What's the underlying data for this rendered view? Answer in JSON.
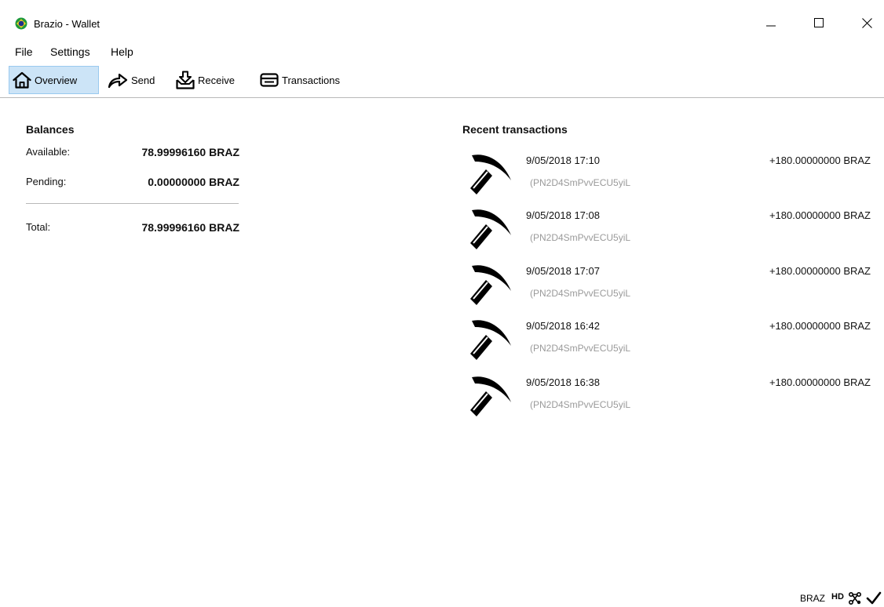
{
  "window": {
    "title": "Brazio - Wallet"
  },
  "menu": {
    "file": "File",
    "settings": "Settings",
    "help": "Help"
  },
  "toolbar": {
    "overview": "Overview",
    "send": "Send",
    "receive": "Receive",
    "transactions": "Transactions"
  },
  "balances": {
    "heading": "Balances",
    "available_label": "Available:",
    "available_value": "78.99996160 BRAZ",
    "pending_label": "Pending:",
    "pending_value": "0.00000000 BRAZ",
    "total_label": "Total:",
    "total_value": "78.99996160 BRAZ"
  },
  "recent": {
    "heading": "Recent transactions",
    "items": [
      {
        "icon": "pickaxe-icon",
        "date": "9/05/2018 17:10",
        "address": "(PN2D4SmPvvECU5yiL",
        "amount": "+180.00000000 BRAZ"
      },
      {
        "icon": "pickaxe-icon",
        "date": "9/05/2018 17:08",
        "address": "(PN2D4SmPvvECU5yiL",
        "amount": "+180.00000000 BRAZ"
      },
      {
        "icon": "pickaxe-icon",
        "date": "9/05/2018 17:07",
        "address": "(PN2D4SmPvvECU5yiL",
        "amount": "+180.00000000 BRAZ"
      },
      {
        "icon": "pickaxe-icon",
        "date": "9/05/2018 16:42",
        "address": "(PN2D4SmPvvECU5yiL",
        "amount": "+180.00000000 BRAZ"
      },
      {
        "icon": "pickaxe-icon",
        "date": "9/05/2018 16:38",
        "address": "(PN2D4SmPvvECU5yiL",
        "amount": "+180.00000000 BRAZ"
      }
    ]
  },
  "statusbar": {
    "unit": "BRAZ",
    "hd": "HD"
  },
  "colors": {
    "toolbar_active_bg": "#cce4f7",
    "toolbar_active_border": "#99c9ef",
    "address_text": "#9a9a9a",
    "flag_green": "#1e9a3c",
    "flag_yellow": "#f6d21d",
    "flag_blue": "#1d2f8a"
  }
}
